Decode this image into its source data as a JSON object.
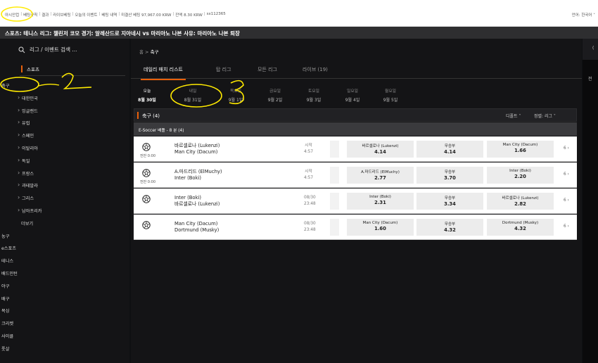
{
  "top": {
    "links": [
      "아시안컵",
      "베팅규칙",
      "결과",
      "라이브베팅",
      "오늘의 이벤트",
      "베팅 내역",
      "미결산 베팅 97,967.00 KRW",
      "잔액 8.30 KRW",
      "sx112365"
    ],
    "lang": "언어: 한국어 ˅"
  },
  "match_bar": "스포츠: 테니스 리그: 챌린저 코모 경기: 알레산드로 지아네시 vs 마리아노 나본 사유: 마리아노 나본 퇴장",
  "sidebar": {
    "search_placeholder": "리그 / 이벤트 검색 ...",
    "sports_label": "스포츠",
    "items": [
      {
        "label": "축구",
        "sub": false
      },
      {
        "label": "대한민국",
        "sub": true
      },
      {
        "label": "잉글랜드",
        "sub": true
      },
      {
        "label": "유럽",
        "sub": true
      },
      {
        "label": "스페인",
        "sub": true
      },
      {
        "label": "이탈리아",
        "sub": true
      },
      {
        "label": "독일",
        "sub": true
      },
      {
        "label": "프랑스",
        "sub": true
      },
      {
        "label": "과테말라",
        "sub": true
      },
      {
        "label": "그리스",
        "sub": true
      },
      {
        "label": "남아프리카",
        "sub": true
      },
      {
        "label": "더보기",
        "sub": false,
        "indent": true
      },
      {
        "label": "농구",
        "sub": false
      },
      {
        "label": "e스포츠",
        "sub": false
      },
      {
        "label": "테니스",
        "sub": false
      },
      {
        "label": "배드민턴",
        "sub": false
      },
      {
        "label": "야구",
        "sub": false
      },
      {
        "label": "배구",
        "sub": false
      },
      {
        "label": "복싱",
        "sub": false
      },
      {
        "label": "크리켓",
        "sub": false
      },
      {
        "label": "사이클",
        "sub": false
      },
      {
        "label": "풋살",
        "sub": false
      }
    ]
  },
  "breadcrumb": {
    "home": "홈 > ",
    "current": "축구"
  },
  "tabs": [
    "데일리 매치 리스트",
    "탑 리그",
    "모든 리그",
    "라이브 (19)"
  ],
  "days": [
    {
      "name": "오늘",
      "date": "8월 30일"
    },
    {
      "name": "내일",
      "date": "8월 31일"
    },
    {
      "name": "목요일",
      "date": "9월 1일"
    },
    {
      "name": "금요일",
      "date": "9월 2일"
    },
    {
      "name": "토요일",
      "date": "9월 3일"
    },
    {
      "name": "일요일",
      "date": "9월 4일"
    },
    {
      "name": "월요일",
      "date": "9월 5일"
    }
  ],
  "section": {
    "title": "축구 (4)",
    "default": "디폴트 ˅",
    "sort": "정렬: 리그 ˅"
  },
  "league": "E-Soccer 배틀 - 8 분 (4)",
  "matches": [
    {
      "home": "바르셀로나 (Lukenzi)",
      "away": "Man City (Dacum)",
      "s1": "시작",
      "s2": "4:57",
      "time": "전반 0:00",
      "o1n": "바르셀로나 (Lukenzi)",
      "o1": "4.14",
      "o2n": "무승부",
      "o2": "4.14",
      "o3n": "Man City (Dacum)",
      "o3": "1.66",
      "more": "6 ›"
    },
    {
      "home": "A.마드리드 (ElMuchy)",
      "away": "Inter (Boki)",
      "s1": "시작",
      "s2": "4:57",
      "time": "전반 0:00",
      "o1n": "A.마드리드 (ElMuchy)",
      "o1": "2.77",
      "o2n": "무승부",
      "o2": "3.70",
      "o3n": "Inter (Boki)",
      "o3": "2.20",
      "more": "6 ›"
    },
    {
      "home": "Inter (Boki)",
      "away": "바르셀로나 (Lukenzi)",
      "s1": "08/30",
      "s2": "23:48",
      "time": "",
      "o1n": "Inter (Boki)",
      "o1": "2.31",
      "o2n": "무승부",
      "o2": "3.34",
      "o3n": "바르셀로나 (Lukenzi)",
      "o3": "2.82",
      "more": "6 ›"
    },
    {
      "home": "Man City (Dacum)",
      "away": "Dortmund (Musky)",
      "s1": "08/30",
      "s2": "23:48",
      "time": "",
      "o1n": "Man City (Dacum)",
      "o1": "1.60",
      "o2n": "무승부",
      "o2": "4.32",
      "o3n": "Dortmund (Musky)",
      "o3": "4.32",
      "more": "6 ›"
    }
  ],
  "right_panel": {
    "u": "(",
    "t": "전"
  },
  "colors": {
    "accent": "#e8600a",
    "annotation": "#ffea00"
  }
}
